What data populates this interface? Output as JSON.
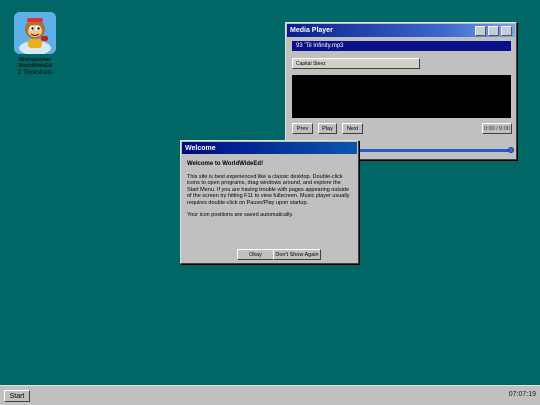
{
  "desktop": {
    "icon": {
      "name_text": "Mishapsolver\nWorldWideEd",
      "caption": "2 Trickshots"
    }
  },
  "media_player": {
    "title": "Media Player",
    "track": "93 'Til Infinity.mp3",
    "station": "Capital Steez",
    "buttons": {
      "prev": "Prev",
      "play": "Play",
      "next": "Next"
    },
    "time": "0:00 / 0:00",
    "volume_fraction": 1.0
  },
  "welcome": {
    "title": "Welcome",
    "heading": "Welcome to WorldWideEd!",
    "paragraph": "This site is best experienced like a classic desktop. Double-click icons to open programs, drag windows around, and explore the Start Menu. If you are having trouble with pages appearing outside of the screen try hitting F11 to view fullscreen. Music player usually requires double-click on Pause/Play upon startup.",
    "note": "Your icon positions are saved automatically.",
    "okay_label": "Okay",
    "dont_show_label": "Don't Show Again"
  },
  "taskbar": {
    "start_label": "Start",
    "clock": "07:07:19"
  },
  "colors": {
    "desktop": "#006666",
    "window": "#c0c0c0",
    "title_active": "#0a1e8c",
    "track_bg": "#0a1088"
  }
}
